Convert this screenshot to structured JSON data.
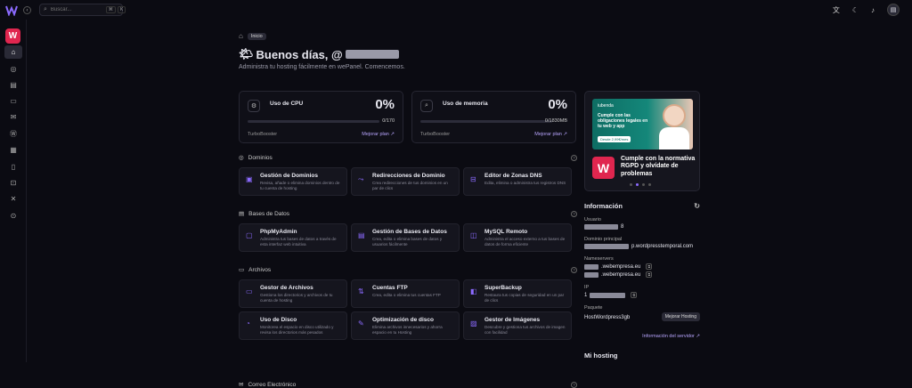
{
  "topbar": {
    "search_placeholder": "Buscar...",
    "kbd_1": "⌘",
    "kbd_2": "K"
  },
  "sidebar": {
    "brand_letter": "W",
    "items": [
      {
        "icon": "home-icon",
        "glyph": "⌂",
        "active": true
      },
      {
        "icon": "globe-icon",
        "glyph": "◎"
      },
      {
        "icon": "database-icon",
        "glyph": "▤"
      },
      {
        "icon": "folder-icon",
        "glyph": "▭"
      },
      {
        "icon": "mail-icon",
        "glyph": "✉"
      },
      {
        "icon": "wordpress-icon",
        "glyph": "Ⓦ"
      },
      {
        "icon": "calendar-icon",
        "glyph": "▦"
      },
      {
        "icon": "file-icon",
        "glyph": "▯"
      },
      {
        "icon": "lock-icon",
        "glyph": "⊡"
      },
      {
        "icon": "tools-icon",
        "glyph": "✕"
      },
      {
        "icon": "user-icon",
        "glyph": "⊙"
      }
    ]
  },
  "breadcrumb": {
    "label": "Inicio"
  },
  "greeting": {
    "emoji": "🌤",
    "text": "Buenos días, @",
    "subtitle": "Administra tu hosting fácilmente en wePanel. Comencemos."
  },
  "usage": [
    {
      "label": "Uso de CPU",
      "percent": "0%",
      "value": "0/170",
      "fraction": 0,
      "footer": "TurboBooster",
      "link": "Mejorar plan ↗",
      "icon": "cpu-icon",
      "glyph": "⚙"
    },
    {
      "label": "Uso de memoria",
      "percent": "0%",
      "value": "0/1830MB",
      "fraction": 0,
      "footer": "TurboBooster",
      "link": "Mejorar plan ↗",
      "icon": "memory-icon",
      "glyph": "⌕"
    }
  ],
  "sections": [
    {
      "title": "Dominios",
      "icon": "globe-icon",
      "glyph": "◎",
      "tiles": [
        {
          "title": "Gestión de Dominios",
          "desc": "Revisa, añade o elimina dominios dentro de tu cuenta de hosting",
          "icon": "domains-icon",
          "glyph": "▣"
        },
        {
          "title": "Redirecciones de Dominio",
          "desc": "Crea redirecciones de tus dominios en un par de clics",
          "icon": "redirect-icon",
          "glyph": "⤳"
        },
        {
          "title": "Editor de Zonas DNS",
          "desc": "Edita, elimina o administra tus registros DNS",
          "icon": "dns-icon",
          "glyph": "⊟"
        }
      ]
    },
    {
      "title": "Bases de Datos",
      "icon": "database-icon",
      "glyph": "▤",
      "tiles": [
        {
          "title": "PhpMyAdmin",
          "desc": "Administra tus bases de datos a través de esta interfaz web intuitiva",
          "icon": "phpmyadmin-icon",
          "glyph": "▢"
        },
        {
          "title": "Gestión de Bases de Datos",
          "desc": "Crea, edita o elimina bases de datos y usuarios fácilmente",
          "icon": "db-manage-icon",
          "glyph": "▤"
        },
        {
          "title": "MySQL Remoto",
          "desc": "Administra el acceso externo a tus bases de datos de forma eficiente",
          "icon": "mysql-remote-icon",
          "glyph": "◫"
        }
      ]
    },
    {
      "title": "Archivos",
      "icon": "folder-icon",
      "glyph": "▭",
      "tiles": [
        {
          "title": "Gestor de Archivos",
          "desc": "Gestiona los directorios y archivos de tu cuenta de hosting",
          "icon": "file-manager-icon",
          "glyph": "▭"
        },
        {
          "title": "Cuentas FTP",
          "desc": "Crea, edita o elimina tus cuentas FTP",
          "icon": "ftp-icon",
          "glyph": "⇅"
        },
        {
          "title": "SuperBackup",
          "desc": "Restaura tus copias de seguridad en un par de clics",
          "icon": "backup-icon",
          "glyph": "◧"
        },
        {
          "title": "Uso de Disco",
          "desc": "Monitorea el espacio en disco utilizado y revisa los directorios más pesados",
          "icon": "disk-icon",
          "glyph": "◔"
        },
        {
          "title": "Optimización de disco",
          "desc": "Elimina archivos innecesarios y ahorra espacio en tu Hosting",
          "icon": "optimize-icon",
          "glyph": "✎"
        },
        {
          "title": "Gestor de Imágenes",
          "desc": "Descubre y gestiona tus archivos de imagen con facilidad",
          "icon": "image-icon",
          "glyph": "▨"
        }
      ]
    },
    {
      "title": "Correo Electrónico",
      "icon": "mail-icon",
      "glyph": "✉",
      "tiles": []
    }
  ],
  "promo": {
    "brand": "iubenda",
    "image_text": "Cumple con las obligaciones legales en tu web y app",
    "image_button": "Desde 2,99€/mes",
    "logo_letter": "W",
    "title": "Cumple con la normativa RGPD y olvídate de problemas"
  },
  "info": {
    "title": "Información",
    "user_label": "Usuario",
    "user_value_suffix": "8",
    "domain_label": "Dominio principal",
    "domain_value": "p.wordpresstemporal.com",
    "ns_label": "Nameservers",
    "ns1": ".webempresa.eu",
    "ns2": ".webempresa.eu",
    "ip_label": "IP",
    "ip_prefix": "1",
    "package_label": "Paquete",
    "package_value": "HostWordpress3gb",
    "upgrade_button": "Mejorar Hosting",
    "server_link": "Información del servidor ↗"
  },
  "hosting": {
    "title": "Mi hosting"
  }
}
